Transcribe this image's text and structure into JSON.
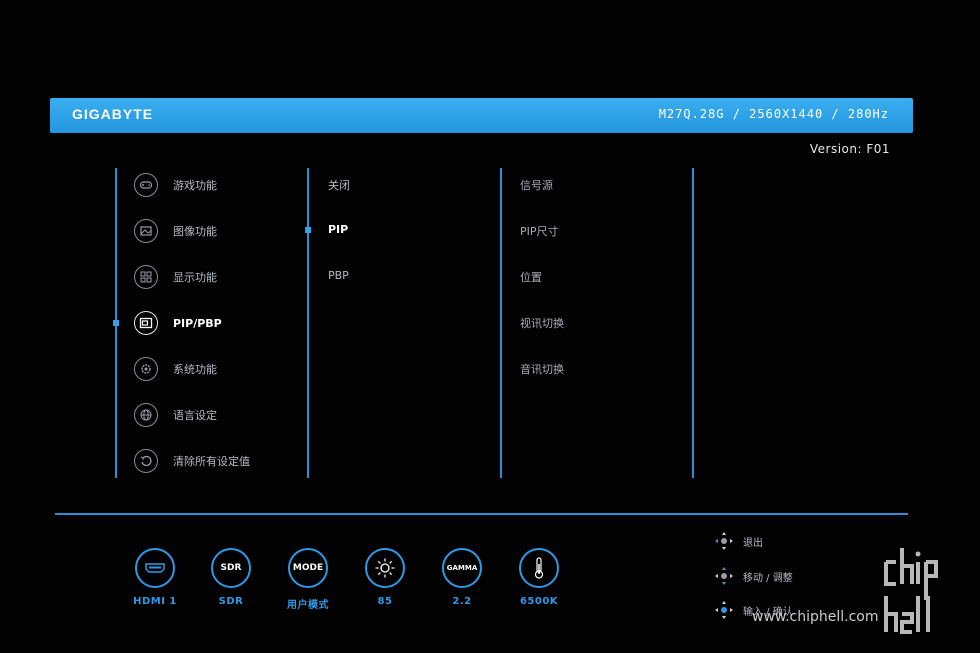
{
  "header": {
    "brand": "GIGABYTE",
    "model_info": "M27Q.28G / 2560X1440 / 280Hz"
  },
  "version": "Version: F01",
  "main_menu": [
    {
      "label": "游戏功能",
      "icon": "gamepad-icon"
    },
    {
      "label": "图像功能",
      "icon": "picture-icon"
    },
    {
      "label": "显示功能",
      "icon": "display-grid-icon"
    },
    {
      "label": "PIP/PBP",
      "icon": "pip-icon",
      "active": true
    },
    {
      "label": "系统功能",
      "icon": "system-gear-icon"
    },
    {
      "label": "语言设定",
      "icon": "globe-icon"
    },
    {
      "label": "清除所有设定值",
      "icon": "reset-icon"
    }
  ],
  "sub_menu": [
    {
      "label": "关闭"
    },
    {
      "label": "PIP",
      "active": true
    },
    {
      "label": "PBP"
    }
  ],
  "options": [
    "信号源",
    "PIP尺寸",
    "位置",
    "视讯切换",
    "音讯切换"
  ],
  "status_bar": [
    {
      "icon_text": "",
      "caption": "HDMI 1",
      "icon": "hdmi-icon"
    },
    {
      "icon_text": "SDR",
      "caption": "SDR",
      "icon": "sdr-icon"
    },
    {
      "icon_text": "MODE",
      "caption": "用户模式",
      "icon": "mode-icon"
    },
    {
      "icon_text": "",
      "caption": "85",
      "icon": "brightness-icon"
    },
    {
      "icon_text": "GAMMA",
      "caption": "2.2",
      "icon": "gamma-icon"
    },
    {
      "icon_text": "",
      "caption": "6500K",
      "icon": "thermometer-icon"
    }
  ],
  "hints": [
    {
      "label": "退出",
      "icon": "dpad-left-icon"
    },
    {
      "label": "移动 / 调整",
      "icon": "dpad-updown-icon"
    },
    {
      "label": "输入 / 确认",
      "icon": "dpad-press-icon"
    }
  ],
  "watermark": "www.chiphell.com",
  "colors": {
    "accent": "#2f99e6",
    "header": "#2ea3ea",
    "background": "#020203"
  }
}
